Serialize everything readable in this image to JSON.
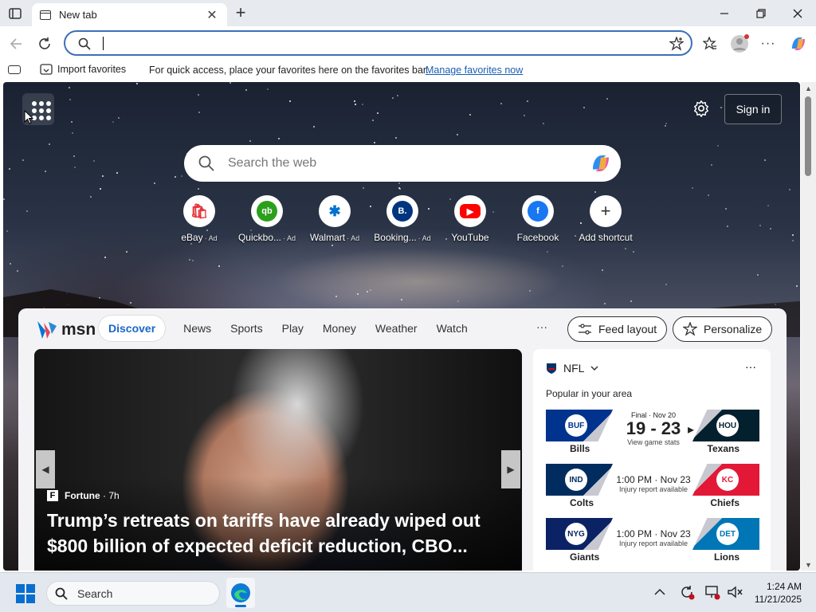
{
  "browser": {
    "tab_title": "New tab",
    "new_tab": "+",
    "address_value": ""
  },
  "favorites_bar": {
    "import_label": "Import favorites",
    "hint": "For quick access, place your favorites here on the favorites bar.",
    "manage_link": "Manage favorites now"
  },
  "page": {
    "signin_label": "Sign in",
    "search_placeholder": "Search the web",
    "shortcuts": [
      {
        "label": "eBay",
        "ad": "· Ad",
        "icon": "ebay-icon",
        "color": "#e53238"
      },
      {
        "label": "Quickbo...",
        "ad": "· Ad",
        "icon": "quickbooks-icon",
        "color": "#2ca01c"
      },
      {
        "label": "Walmart",
        "ad": "· Ad",
        "icon": "walmart-icon",
        "color": "#0071ce"
      },
      {
        "label": "Booking...",
        "ad": "· Ad",
        "icon": "booking-icon",
        "color": "#003580"
      },
      {
        "label": "YouTube",
        "ad": "",
        "icon": "youtube-icon",
        "color": "#ff0000"
      },
      {
        "label": "Facebook",
        "ad": "",
        "icon": "facebook-icon",
        "color": "#1877f2"
      },
      {
        "label": "Add shortcut",
        "ad": "",
        "icon": "plus-icon",
        "color": "#333333"
      }
    ]
  },
  "msn": {
    "logo_text": "msn",
    "tabs": [
      "Discover",
      "News",
      "Sports",
      "Play",
      "Money",
      "Weather",
      "Watch"
    ],
    "more": "···",
    "feed_layout": "Feed layout",
    "personalize": "Personalize",
    "hero": {
      "source": "Fortune",
      "source_time": "· 7h",
      "headline": "Trump’s retreats on tariffs have already wiped out $800 billion of expected deficit reduction, CBO..."
    },
    "nfl": {
      "title": "NFL",
      "popular": "Popular in your area",
      "games": [
        {
          "team1": "Bills",
          "team2": "Texans",
          "status": "Final · Nov 20",
          "score": "19 - 23",
          "note": "View game stats",
          "color1": "#00338d",
          "color2": "#03202f",
          "abbr1": "BUF",
          "abbr2": "HOU"
        },
        {
          "team1": "Colts",
          "team2": "Chiefs",
          "status": "1:00 PM · Nov 23",
          "score": "",
          "note": "Injury report available",
          "color1": "#002c5f",
          "color2": "#e31837",
          "abbr1": "IND",
          "abbr2": "KC"
        },
        {
          "team1": "Giants",
          "team2": "Lions",
          "status": "1:00 PM · Nov 23",
          "score": "",
          "note": "Injury report available",
          "color1": "#0b2265",
          "color2": "#0076b6",
          "abbr1": "NYG",
          "abbr2": "DET"
        }
      ]
    }
  },
  "taskbar": {
    "search_label": "Search",
    "time": "1:24 AM",
    "date": "11/21/2025"
  }
}
